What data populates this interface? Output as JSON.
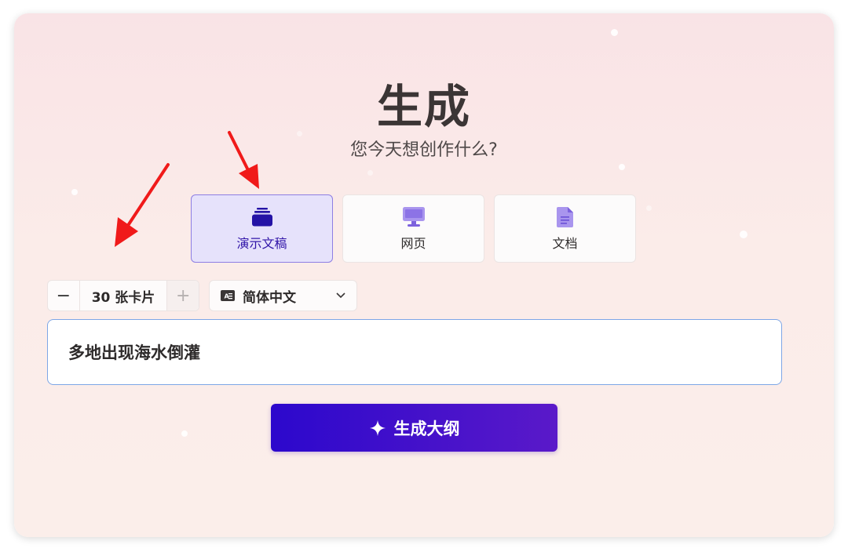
{
  "header": {
    "title": "生成",
    "subtitle": "您今天想创作什么?"
  },
  "content_types": [
    {
      "label": "演示文稿",
      "icon": "stack-icon",
      "selected": true
    },
    {
      "label": "网页",
      "icon": "monitor-icon",
      "selected": false
    },
    {
      "label": "文档",
      "icon": "document-icon",
      "selected": false
    }
  ],
  "options": {
    "card_count_label": "30 张卡片",
    "minus": "−",
    "plus": "+",
    "language": "简体中文"
  },
  "prompt": {
    "value": "多地出现海水倒灌"
  },
  "actions": {
    "generate_label": "生成大纲"
  },
  "colors": {
    "accent": "#3115a8",
    "button_gradient_start": "#2c08cc",
    "button_gradient_end": "#5a19c9",
    "arrow": "#f01a1a"
  }
}
